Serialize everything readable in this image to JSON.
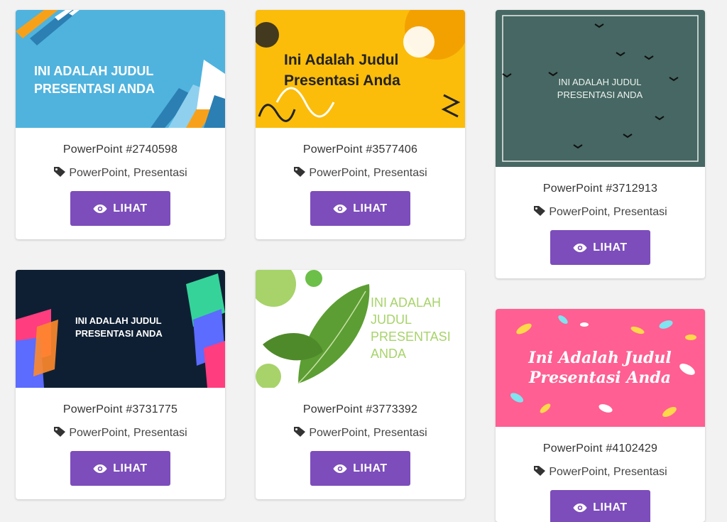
{
  "cards": [
    {
      "title": "PowerPoint #2740598",
      "tags": "PowerPoint, Presentasi",
      "button": "LIHAT",
      "thumb_text_1": "INI ADALAH JUDUL",
      "thumb_text_2": "PRESENTASI ANDA"
    },
    {
      "title": "PowerPoint #3577406",
      "tags": "PowerPoint, Presentasi",
      "button": "LIHAT",
      "thumb_text_1": "Ini Adalah Judul",
      "thumb_text_2": "Presentasi Anda"
    },
    {
      "title": "PowerPoint #3712913",
      "tags": "PowerPoint, Presentasi",
      "button": "LIHAT",
      "thumb_text_1": "INI ADALAH JUDUL",
      "thumb_text_2": "PRESENTASI ANDA"
    },
    {
      "title": "PowerPoint #3731775",
      "tags": "PowerPoint, Presentasi",
      "button": "LIHAT",
      "thumb_text_1": "INI ADALAH JUDUL",
      "thumb_text_2": "PRESENTASI ANDA"
    },
    {
      "title": "PowerPoint #3773392",
      "tags": "PowerPoint, Presentasi",
      "button": "LIHAT",
      "thumb_text_1": "INI ADALAH",
      "thumb_text_2": "JUDUL",
      "thumb_text_3": "PRESENTASI",
      "thumb_text_4": "ANDA"
    },
    {
      "title": "PowerPoint #4102429",
      "tags": "PowerPoint, Presentasi",
      "button": "LIHAT",
      "thumb_text_1": "Ini Adalah Judul",
      "thumb_text_2": "Presentasi Anda"
    }
  ],
  "colors": {
    "button": "#7c4dbb",
    "card_bg": "#ffffff",
    "page_bg": "#f2f2f2"
  },
  "icons": {
    "tag": "tag-icon",
    "view": "eye-icon"
  }
}
